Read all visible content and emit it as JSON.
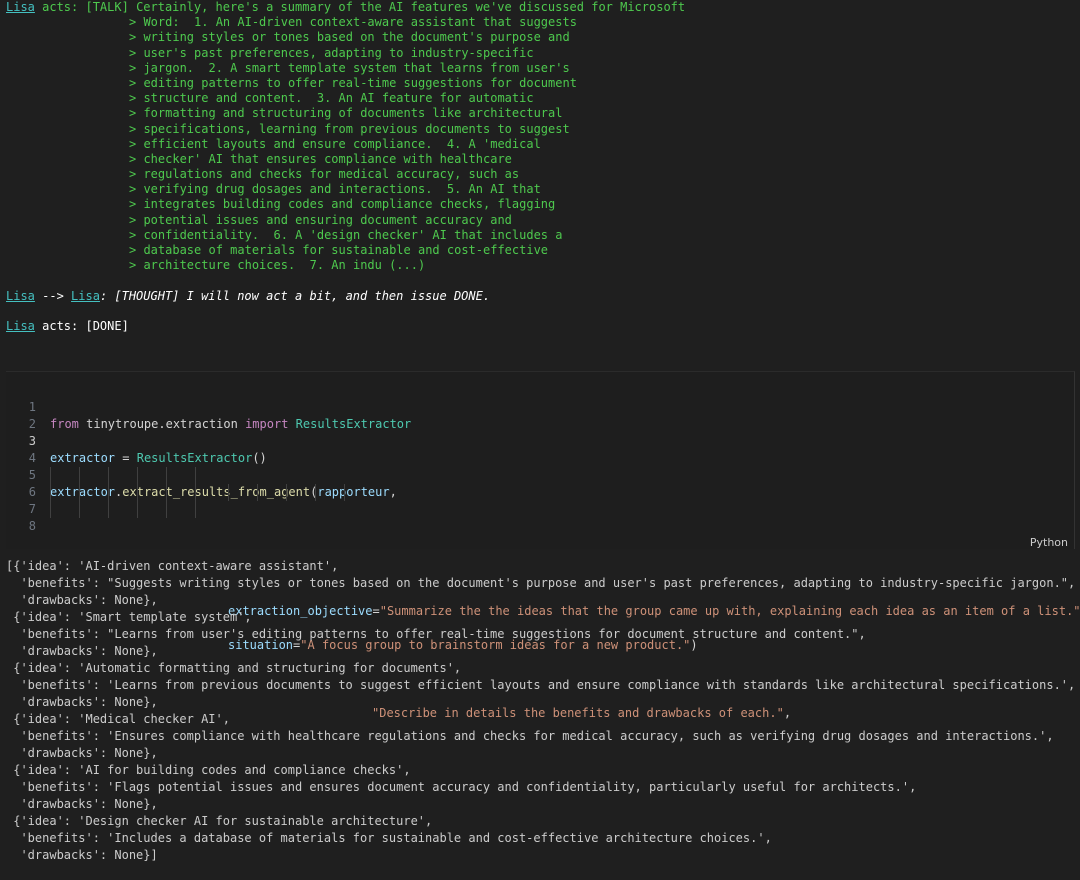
{
  "agent_output": {
    "talk_speaker": "Lisa",
    "talk_prefix": " acts: [TALK] ",
    "talk_lines": [
      "Certainly, here's a summary of the AI features we've discussed for Microsoft",
      "> Word:  1. An AI-driven context-aware assistant that suggests",
      "> writing styles or tones based on the document's purpose and",
      "> user's past preferences, adapting to industry-specific",
      "> jargon.  2. A smart template system that learns from user's",
      "> editing patterns to offer real-time suggestions for document",
      "> structure and content.  3. An AI feature for automatic",
      "> formatting and structuring of documents like architectural",
      "> specifications, learning from previous documents to suggest",
      "> efficient layouts and ensure compliance.  4. A 'medical",
      "> checker' AI that ensures compliance with healthcare",
      "> regulations and checks for medical accuracy, such as",
      "> verifying drug dosages and interactions.  5. An AI that",
      "> integrates building codes and compliance checks, flagging",
      "> potential issues and ensuring document accuracy and",
      "> confidentiality.  6. A 'design checker' AI that includes a",
      "> database of materials for sustainable and cost-effective",
      "> architecture choices.  7. An indu (...)"
    ],
    "thought_from": "Lisa",
    "thought_arrow": " --> ",
    "thought_to": "Lisa",
    "thought_text": ": [THOUGHT] I will now act a bit, and then issue DONE.",
    "done_speaker": "Lisa",
    "done_text": " acts: [DONE]"
  },
  "code_cell": {
    "language": "Python",
    "line_numbers": [
      "1",
      "2",
      "3",
      "4",
      "5",
      "6",
      "7",
      "8"
    ],
    "line1": {
      "kw1": "from",
      "module": " tinytroupe.extraction ",
      "kw2": "import",
      "cls": " ResultsExtractor"
    },
    "line3": {
      "var": "extractor",
      "op": " = ",
      "cls": "ResultsExtractor",
      "paren": "()"
    },
    "line5": {
      "var": "extractor",
      "dot": ".",
      "fn": "extract_results_from_agent",
      "open": "(",
      "arg": "rapporteur",
      "comma": ","
    },
    "line6": {
      "param": "extraction_objective",
      "eq": "=",
      "str": "\"Summarize the the ideas that the group came up with, explaining each idea as an item of a list.\"",
      "cont": " \\"
    },
    "line7": {
      "str": "\"Describe in details the benefits and drawbacks of each.\"",
      "comma": ","
    },
    "line8": {
      "param": "situation",
      "eq": "=",
      "str": "\"A focus group to brainstorm ideas for a new product.\"",
      "close": ")"
    }
  },
  "result_lines": [
    "[{'idea': 'AI-driven context-aware assistant',",
    "  'benefits': \"Suggests writing styles or tones based on the document's purpose and user's past preferences, adapting to industry-specific jargon.\",",
    "  'drawbacks': None},",
    " {'idea': 'Smart template system',",
    "  'benefits': \"Learns from user's editing patterns to offer real-time suggestions for document structure and content.\",",
    "  'drawbacks': None},",
    " {'idea': 'Automatic formatting and structuring for documents',",
    "  'benefits': 'Learns from previous documents to suggest efficient layouts and ensure compliance with standards like architectural specifications.',",
    "  'drawbacks': None},",
    " {'idea': 'Medical checker AI',",
    "  'benefits': 'Ensures compliance with healthcare regulations and checks for medical accuracy, such as verifying drug dosages and interactions.',",
    "  'drawbacks': None},",
    " {'idea': 'AI for building codes and compliance checks',",
    "  'benefits': 'Flags potential issues and ensures document accuracy and confidentiality, particularly useful for architects.',",
    "  'drawbacks': None},",
    " {'idea': 'Design checker AI for sustainable architecture',",
    "  'benefits': 'Includes a database of materials for sustainable and cost-effective architecture choices.',",
    "  'drawbacks': None}]"
  ]
}
